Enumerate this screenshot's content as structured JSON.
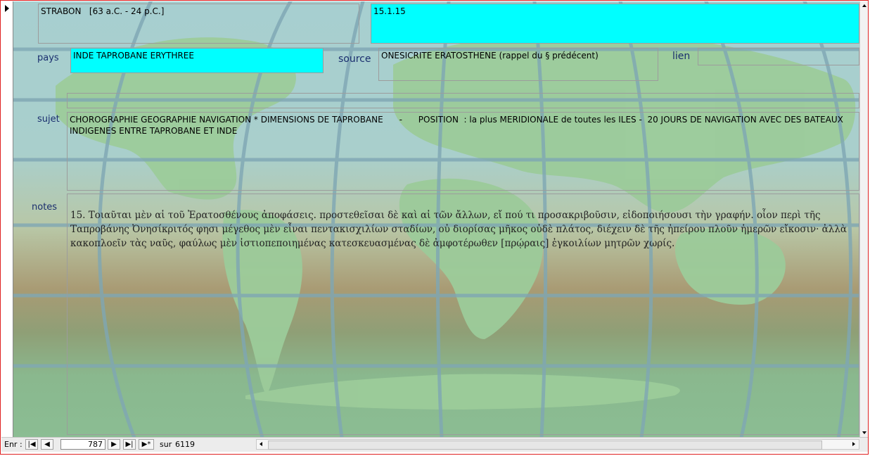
{
  "form": {
    "author": "STRABON   [63 a.C. - 24 p.C.]",
    "reference": "15.1.15",
    "labels": {
      "pays": "pays",
      "source": "source",
      "lien": "lien",
      "sujet": "sujet",
      "notes": "notes"
    },
    "pays": "INDE TAPROBANE ERYTHREE",
    "source": "ONESICRITE ERATOSTHENE (rappel du § prédécent)",
    "lien": "",
    "blank_line": "",
    "sujet": "CHOROGRAPHIE GEOGRAPHIE NAVIGATION * DIMENSIONS DE TAPROBANE      -      POSITION  : la plus MERIDIONALE de toutes les ILES -  20 JOURS DE NAVIGATION AVEC DES BATEAUX INDIGENES ENTRE TAPROBANE ET INDE",
    "notes": "15. Τοιαῦται μὲν αἱ τοῦ Ἐρατοσθένους ἀποφάσεις. προστεθεῖσαι δὲ καὶ αἱ τῶν ἄλλων, εἴ πού τι προσακριβοῦσιν, εἰδοποιήσουσι τὴν γραφήν. οἷον περὶ τῆς Ταπροβάνης Ὀνησίκριτός φησι μέγεθος μὲν εἶναι πεντακισχιλίων σταδίων, οὐ διορίσας μῆκος οὐδὲ πλάτος, διέχειν δὲ τῆς ἠπείρου πλοῦν ἡμερῶν εἴκοσιν· ἀλλὰ κακοπλοεῖν τὰς ναῦς, φαύλως μὲν ἱστιοπεποιημένας κατεσκευασμένας δὲ ἀμφοτέρωθεν [πρῴραις] ἐγκοιλίων μητρῶν χωρίς."
  },
  "navigation": {
    "record_label": "Enr :",
    "current_record": "787",
    "of_label": "sur",
    "total_records": "6119",
    "first_icon": "first-record-icon",
    "prev_icon": "previous-record-icon",
    "next_icon": "next-record-icon",
    "last_icon": "last-record-icon",
    "new_icon": "new-record-icon"
  },
  "colors": {
    "highlight_field": "#00ffff",
    "label_text": "#1a2e6e",
    "window_border": "#e02020"
  }
}
